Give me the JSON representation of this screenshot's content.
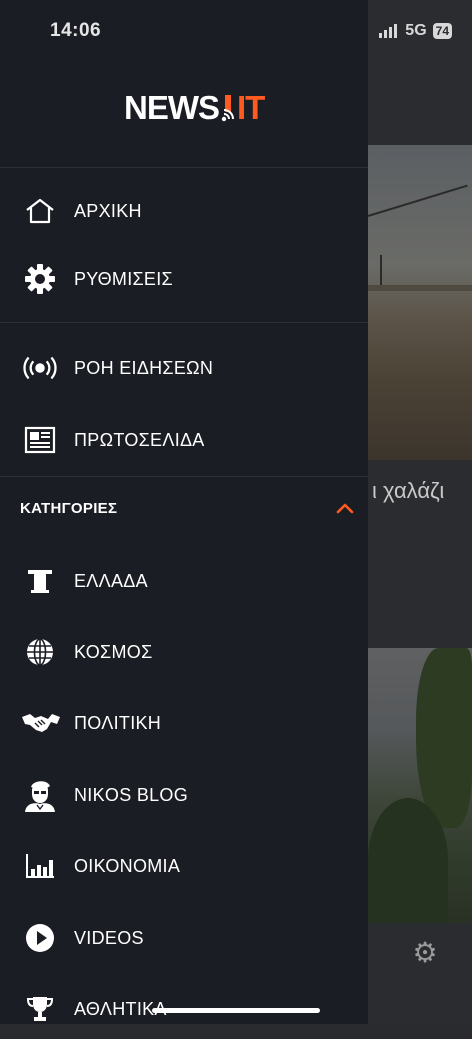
{
  "status_bar": {
    "time": "14:06",
    "network": "5G",
    "battery": "74"
  },
  "app": {
    "logo_main": "NEWS",
    "logo_accent": "IT"
  },
  "menu": {
    "primary": [
      {
        "label": "ΑΡΧΙΚΗ",
        "icon": "home-icon"
      },
      {
        "label": "ΡΥΘΜΙΣΕΙΣ",
        "icon": "gear-icon"
      }
    ],
    "secondary": [
      {
        "label": "ΡΟΗ ΕΙΔΗΣΕΩΝ",
        "icon": "live-broadcast-icon"
      },
      {
        "label": "ΠΡΩΤΟΣΕΛΙΔΑ",
        "icon": "newspaper-icon"
      }
    ],
    "categories_header": "ΚΑΤΗΓΟΡΙΕΣ",
    "categories": [
      {
        "label": "ΕΛΛΑΔΑ",
        "icon": "column-icon"
      },
      {
        "label": "ΚΟΣΜΟΣ",
        "icon": "globe-icon"
      },
      {
        "label": "ΠΟΛΙΤΙΚΗ",
        "icon": "handshake-icon"
      },
      {
        "label": "NIKOS BLOG",
        "icon": "portrait-icon"
      },
      {
        "label": "ΟΙΚΟΝΟΜΙΑ",
        "icon": "bar-chart-icon"
      },
      {
        "label": "VIDEOS",
        "icon": "play-icon"
      },
      {
        "label": "ΑΘΛΗΤΙΚΑ",
        "icon": "trophy-icon"
      }
    ]
  },
  "background": {
    "headline_fragment": "ι χαλάζι"
  },
  "colors": {
    "drawer_bg": "#1b1d24",
    "accent": "#ff5a1f"
  }
}
